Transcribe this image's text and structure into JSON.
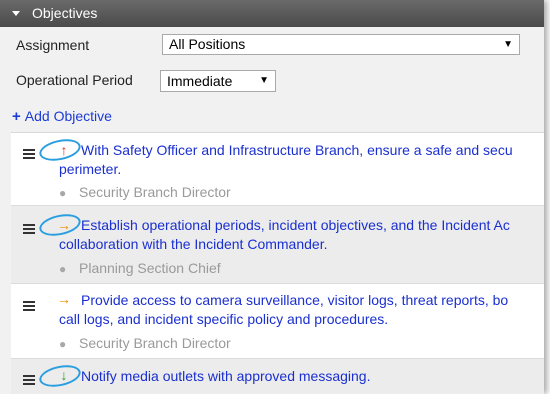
{
  "section": {
    "title": "Objectives"
  },
  "assignment": {
    "label": "Assignment",
    "value": "All Positions"
  },
  "operational_period": {
    "label": "Operational Period",
    "value": "Immediate"
  },
  "add_objective": {
    "label": "Add Objective"
  },
  "objectives": [
    {
      "text": "With Safety Officer and Infrastructure Branch, ensure a safe and secure perimeter.",
      "text_line1": "With Safety Officer and Infrastructure Branch, ensure a safe and secu",
      "text_line2": "perimeter.",
      "priority": "up",
      "priority_color": "#e02a1d",
      "assignee": "Security Branch Director"
    },
    {
      "text": "Establish operational periods, incident objectives, and the Incident Action Plan in collaboration with the Incident Commander.",
      "text_line1": "Establish operational periods, incident objectives, and the Incident Ac",
      "text_line2": "collaboration with the Incident Commander.",
      "priority": "right",
      "priority_color": "#f08a00",
      "assignee": "Planning Section Chief"
    },
    {
      "text": "Provide access to camera surveillance, visitor logs, threat reports, bomb call logs, and incident specific policy and procedures.",
      "text_line1": "Provide access to camera surveillance, visitor logs, threat reports, bo",
      "text_line2": "call logs, and incident specific policy and procedures.",
      "priority": "right",
      "priority_color": "#f08a00",
      "assignee": "Security Branch Director"
    },
    {
      "text": "Notify media outlets with approved messaging.",
      "text_line1": "Notify media outlets with approved messaging.",
      "text_line2": "",
      "priority": "down",
      "priority_color": "#2e9a2e",
      "assignee": ""
    }
  ],
  "colors": {
    "link_blue": "#1a2fd0",
    "annotation_circle": "#2b9ee0"
  }
}
